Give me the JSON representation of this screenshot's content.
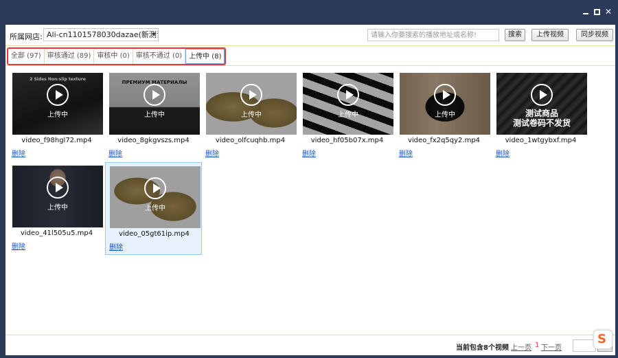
{
  "window": {
    "controls": {
      "minimize": "",
      "maximize": "",
      "close": "✕"
    }
  },
  "toolbar": {
    "store_label": "所属网店:",
    "store_value": "Ali-cn1101578030dazae(新测试",
    "search_placeholder": "请输入你要搜索的播放地址或名称!",
    "search_button": "搜索",
    "upload_button": "上传视频",
    "sync_button": "同步视频"
  },
  "tabs": [
    {
      "label": "全部 (97)",
      "active": false
    },
    {
      "label": "审核通过 (89)",
      "active": false
    },
    {
      "label": "审核中 (0)",
      "active": false
    },
    {
      "label": "审核不通过 (0)",
      "active": false
    },
    {
      "label": "上传中 (8)",
      "active": true
    }
  ],
  "videos": [
    {
      "name": "video_f98hgl72.mp4",
      "status": "上传中",
      "delete": "删除",
      "thumb_text": "2 Sides Non-slip texture"
    },
    {
      "name": "video_8gkgvszs.mp4",
      "status": "上传中",
      "delete": "删除",
      "thumb_text": "ПРЕМИУМ МАТЕРИАЛЫ"
    },
    {
      "name": "video_olfcuqhb.mp4",
      "status": "上传中",
      "delete": "删除",
      "thumb_text": ""
    },
    {
      "name": "video_hf05b07x.mp4",
      "status": "上传中",
      "delete": "删除",
      "thumb_text": ""
    },
    {
      "name": "video_fx2q5qy2.mp4",
      "status": "上传中",
      "delete": "删除",
      "thumb_text": ""
    },
    {
      "name": "video_1wtgybxf.mp4",
      "status": "",
      "delete": "删除",
      "thumb_text": "测试商品\n测试卷码不发货"
    },
    {
      "name": "video_41l505u5.mp4",
      "status": "上传中",
      "delete": "删除",
      "thumb_text": ""
    },
    {
      "name": "video_05gt61ip.mp4",
      "status": "上传中",
      "delete": "删除",
      "thumb_text": ""
    }
  ],
  "footer": {
    "count": "当前包含8个视频",
    "prev": "上一页",
    "page": "1",
    "next": "下一页"
  },
  "colors": {
    "titlebar": "#2c3a5a",
    "tab_highlight": "#e53935",
    "link": "#1a55c9"
  }
}
